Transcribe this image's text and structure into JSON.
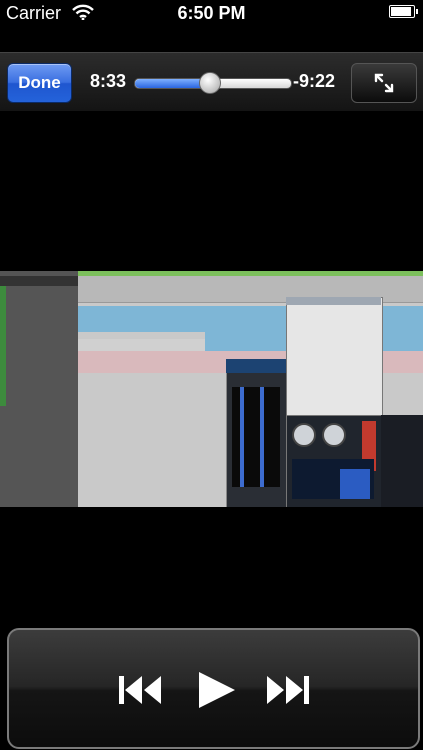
{
  "status_bar": {
    "carrier": "Carrier",
    "time": "6:50 PM",
    "icons": [
      "wifi-icon",
      "battery-icon"
    ]
  },
  "player": {
    "done_label": "Done",
    "elapsed": "8:33",
    "remaining": "-9:22",
    "progress": 0.48,
    "fullscreen_icon": "expand-arrows-icon"
  },
  "transport": {
    "icons": [
      "skip-back-icon",
      "play-icon",
      "skip-forward-icon"
    ]
  },
  "colors": {
    "done_blue": "#2463da",
    "progress_blue": "#2a66e0"
  }
}
